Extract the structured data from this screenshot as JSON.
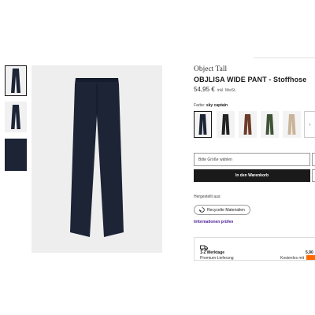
{
  "product": {
    "brand": "Object Tall",
    "title": "OBJLISA WIDE PANT - Stoffhose",
    "price": "54,95 €",
    "vat_note": "inkl. MwSt."
  },
  "color": {
    "label": "Farbe:",
    "selected": "sky captain",
    "swatches": [
      {
        "name": "sky captain",
        "hex": "#1c2436"
      },
      {
        "name": "black",
        "hex": "#222222"
      },
      {
        "name": "brown",
        "hex": "#6b3c28"
      },
      {
        "name": "green",
        "hex": "#3f5236"
      },
      {
        "name": "beige",
        "hex": "#c9b49a"
      }
    ],
    "more_symbol": "›"
  },
  "size_select": {
    "placeholder": "Bitte Größe wählen"
  },
  "cart_button": {
    "label": "In den Warenkorb"
  },
  "materials": {
    "heading": "Hergestellt aus:",
    "badge": "Recycelte Materialien",
    "info_link": "Informationen prüfen"
  },
  "delivery": {
    "days": "1-2 Werktage",
    "type": "Premium-Lieferung",
    "price": "5,90",
    "free_note": "Kostenlos mit"
  },
  "icons": {
    "truck": "truck-icon",
    "recycle": "recycle-icon",
    "chevron": "chevron-right-icon"
  },
  "colors": {
    "accent": "#1a1a1a",
    "link": "#4a1c96",
    "badge": "#ff6900"
  }
}
